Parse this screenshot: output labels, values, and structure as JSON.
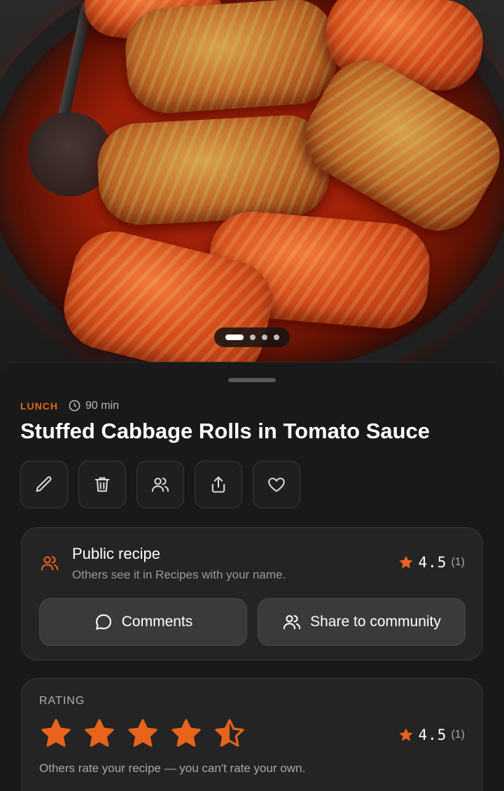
{
  "hero": {
    "image_alt": "Stuffed cabbage rolls in tomato sauce",
    "carousel_count": 4,
    "carousel_active": 0
  },
  "recipe": {
    "category": "LUNCH",
    "time": "90 min",
    "title": "Stuffed Cabbage Rolls in Tomato Sauce"
  },
  "actions": [
    {
      "icon": "pencil-icon"
    },
    {
      "icon": "trash-icon"
    },
    {
      "icon": "users-icon"
    },
    {
      "icon": "share-icon"
    },
    {
      "icon": "heart-icon"
    }
  ],
  "public": {
    "title": "Public recipe",
    "subtitle": "Others see it in Recipes with your name.",
    "score": "4.5",
    "count": "(1)",
    "comments_label": "Comments",
    "share_label": "Share to community"
  },
  "rating": {
    "label": "RATING",
    "stars_value": 4.5,
    "score": "4.5",
    "count": "(1)",
    "note": "Others rate your recipe — you can't rate your own."
  },
  "colors": {
    "accent": "#e8631c",
    "background": "#191919",
    "card": "#242424"
  }
}
